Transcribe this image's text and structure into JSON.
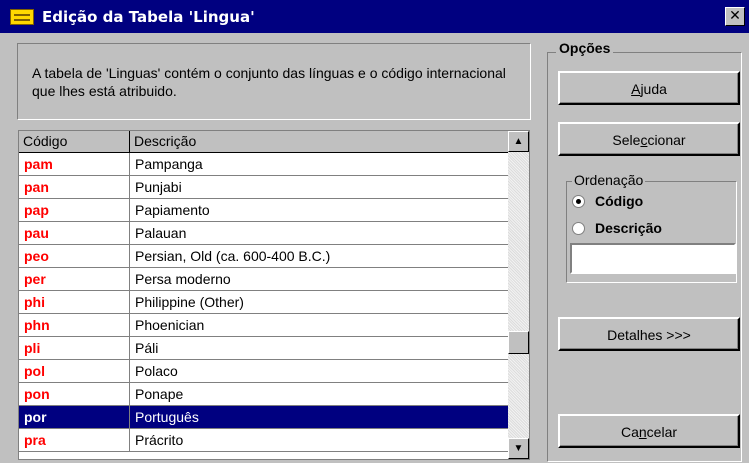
{
  "window": {
    "title": "Edição da Tabela 'Lingua'",
    "close_glyph": "✕",
    "title_icon": "table-icon"
  },
  "info": {
    "text": "A tabela de 'Linguas' contém o conjunto das línguas e o código internacional que lhes está atribuido."
  },
  "grid": {
    "columns": [
      "Código",
      "Descrição"
    ],
    "rows": [
      {
        "code": "pam",
        "desc": "Pampanga"
      },
      {
        "code": "pan",
        "desc": "Punjabi"
      },
      {
        "code": "pap",
        "desc": "Papiamento"
      },
      {
        "code": "pau",
        "desc": "Palauan"
      },
      {
        "code": "peo",
        "desc": "Persian, Old (ca. 600-400 B.C.)"
      },
      {
        "code": "per",
        "desc": "Persa moderno"
      },
      {
        "code": "phi",
        "desc": "Philippine (Other)"
      },
      {
        "code": "phn",
        "desc": "Phoenician"
      },
      {
        "code": "pli",
        "desc": "Páli"
      },
      {
        "code": "pol",
        "desc": "Polaco"
      },
      {
        "code": "pon",
        "desc": "Ponape"
      },
      {
        "code": "por",
        "desc": "Português"
      },
      {
        "code": "pra",
        "desc": "Prácrito"
      }
    ],
    "selected_index": 11,
    "code_color": "#ff0000",
    "selection_color": "#000080"
  },
  "options": {
    "title": "Opções",
    "help": {
      "pre": "",
      "accel": "A",
      "post": "juda"
    },
    "select": {
      "pre": "Sele",
      "accel": "c",
      "post": "cionar"
    },
    "sort": {
      "title": "Ordenação",
      "option_code": "Código",
      "option_desc": "Descrição",
      "selected": "Código",
      "search_value": ""
    },
    "details": {
      "label": "Detalhes >>>"
    },
    "cancel": {
      "pre": "Ca",
      "accel": "n",
      "post": "celar"
    }
  }
}
